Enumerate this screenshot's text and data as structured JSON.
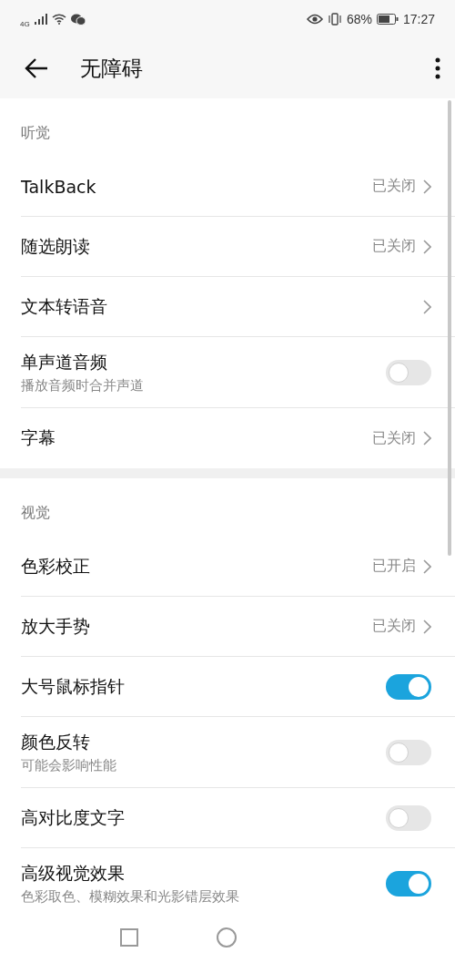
{
  "status_bar": {
    "network": "4G",
    "battery": "68%",
    "time": "17:27"
  },
  "header": {
    "title": "无障碍"
  },
  "sections": [
    {
      "title": "听觉",
      "rows": [
        {
          "kind": "link",
          "label": "TalkBack",
          "value": "已关闭"
        },
        {
          "kind": "link",
          "label": "随选朗读",
          "value": "已关闭"
        },
        {
          "kind": "link",
          "label": "文本转语音"
        },
        {
          "kind": "switch",
          "label": "单声道音频",
          "subtitle": "播放音频时合并声道",
          "on": false
        },
        {
          "kind": "link",
          "label": "字幕",
          "value": "已关闭"
        }
      ]
    },
    {
      "title": "视觉",
      "rows": [
        {
          "kind": "link",
          "label": "色彩校正",
          "value": "已开启"
        },
        {
          "kind": "link",
          "label": "放大手势",
          "value": "已关闭"
        },
        {
          "kind": "switch",
          "label": "大号鼠标指针",
          "on": true
        },
        {
          "kind": "switch",
          "label": "颜色反转",
          "subtitle": "可能会影响性能",
          "on": false
        },
        {
          "kind": "switch",
          "label": "高对比度文字",
          "on": false
        },
        {
          "kind": "switch",
          "label": "高级视觉效果",
          "subtitle": "色彩取色、模糊效果和光影错层效果",
          "on": true
        }
      ]
    }
  ]
}
